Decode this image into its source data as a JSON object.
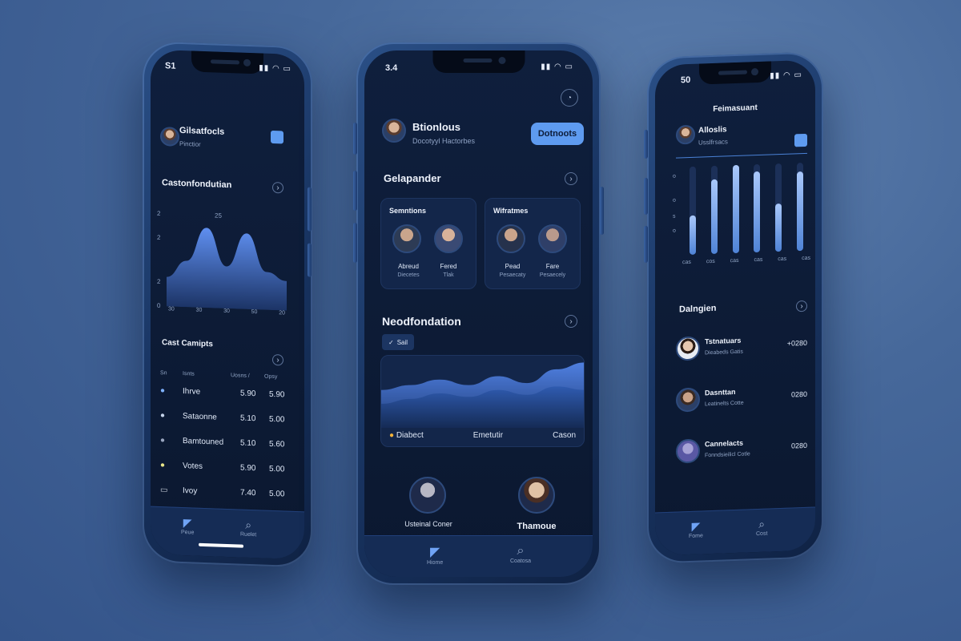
{
  "left_phone": {
    "status_time": "S1",
    "status_icons": "▮▮ ◠ ▭",
    "profile": {
      "name": "Gilsatfocls",
      "subtitle": "Pinctior"
    },
    "section_title": "Castonfondutian",
    "chart_y_ticks": [
      "2",
      "2",
      "2",
      "0"
    ],
    "chart_peak_label": "25",
    "chart_x_ticks": [
      "30",
      "30",
      "30",
      "50",
      "20"
    ],
    "list_title": "Cast Camipts",
    "list_headers": [
      "Sn",
      "Isnts",
      "Uosns /",
      "Opsy"
    ],
    "list_rows": [
      {
        "name": "Ihrve",
        "v1": "5.90",
        "v2": "5.90"
      },
      {
        "name": "Sataonne",
        "v1": "5.10",
        "v2": "5.00"
      },
      {
        "name": "Bamtouned",
        "v1": "5.10",
        "v2": "5.60"
      },
      {
        "name": "Votes",
        "v1": "5.90",
        "v2": "5.00"
      },
      {
        "name": "Ivoy",
        "v1": "7.40",
        "v2": "5.00"
      }
    ],
    "nav": [
      {
        "label": "Peue"
      },
      {
        "label": "Ruelet"
      }
    ]
  },
  "center_phone": {
    "status_time": "3.4",
    "status_icons": "▮▮ ◠ ▭",
    "profile": {
      "name": "Btionlous",
      "subtitle": "Docotyyl Hactorbes"
    },
    "action_button": "Dotnoots",
    "section1_title": "Gelapander",
    "card_left": {
      "title": "Semntions",
      "people": [
        {
          "name": "Abreud",
          "role": "Diecetes"
        },
        {
          "name": "Fered",
          "role": "Tlak"
        }
      ]
    },
    "card_right": {
      "title": "Wifratmes",
      "people": [
        {
          "name": "Pead",
          "role": "Pesaecaty"
        },
        {
          "name": "Fare",
          "role": "Pesaecely"
        }
      ]
    },
    "section2_title": "Neodfondation",
    "chip_label": "Sail",
    "legend": [
      "Diabect",
      "Emetutir",
      "Cason"
    ],
    "bottom_people": [
      {
        "name": "Usteinal Coner"
      },
      {
        "name": "Thamoue"
      }
    ],
    "nav": [
      {
        "label": "Hiome"
      },
      {
        "label": "Coatosa"
      }
    ]
  },
  "right_phone": {
    "status_time": "50",
    "status_icons": "▮▮ ◠ ▭",
    "header": "Feimasuant",
    "profile": {
      "name": "Alloslis",
      "subtitle": "Usslfrsacs"
    },
    "chart_y_ticks": [
      "o",
      "o",
      "s",
      "o"
    ],
    "chart_x_ticks": [
      "cas",
      "cos",
      "cas",
      "cas",
      "cas",
      "cas"
    ],
    "section_title": "Dalngien",
    "list": [
      {
        "name": "Tstnatuars",
        "subtitle": "Dieabeds Gatis",
        "value": "+0280"
      },
      {
        "name": "Dasnttan",
        "subtitle": "Leatinelts Cotte",
        "value": "0280"
      },
      {
        "name": "Cannelacts",
        "subtitle": "Fonndsieilicl Cotle",
        "value": "0280"
      }
    ],
    "nav": [
      {
        "label": "Fome"
      },
      {
        "label": "Cost"
      }
    ]
  },
  "chart_data": [
    {
      "type": "area",
      "title": "Castonfondutian",
      "x": [
        "30",
        "30",
        "30",
        "50",
        "20"
      ],
      "values": [
        0.35,
        0.55,
        0.95,
        0.5,
        0.9,
        0.45,
        0.35
      ],
      "series": [
        {
          "values": [
            0.35,
            0.55,
            0.95,
            0.5,
            0.9,
            0.45,
            0.35
          ]
        }
      ]
    },
    {
      "type": "area",
      "title": "Neodfondation",
      "categories": [
        "Diabect",
        "Emetutir",
        "Cason"
      ],
      "series": [
        {
          "values": [
            0.55,
            0.62,
            0.7,
            0.62,
            0.75,
            0.65,
            0.85,
            0.95
          ]
        },
        {
          "values": [
            0.35,
            0.42,
            0.5,
            0.45,
            0.55,
            0.48,
            0.6,
            0.55
          ]
        }
      ]
    },
    {
      "type": "bar",
      "categories": [
        "cas",
        "cos",
        "cas",
        "cas",
        "cas",
        "cas"
      ],
      "values": [
        0.45,
        0.85,
        1.0,
        0.92,
        0.55,
        0.9
      ],
      "ylim": [
        0,
        1
      ]
    }
  ],
  "colors": {
    "accent": "#5e9bf0",
    "background": "#0f1f3d",
    "card": "#13264a"
  }
}
